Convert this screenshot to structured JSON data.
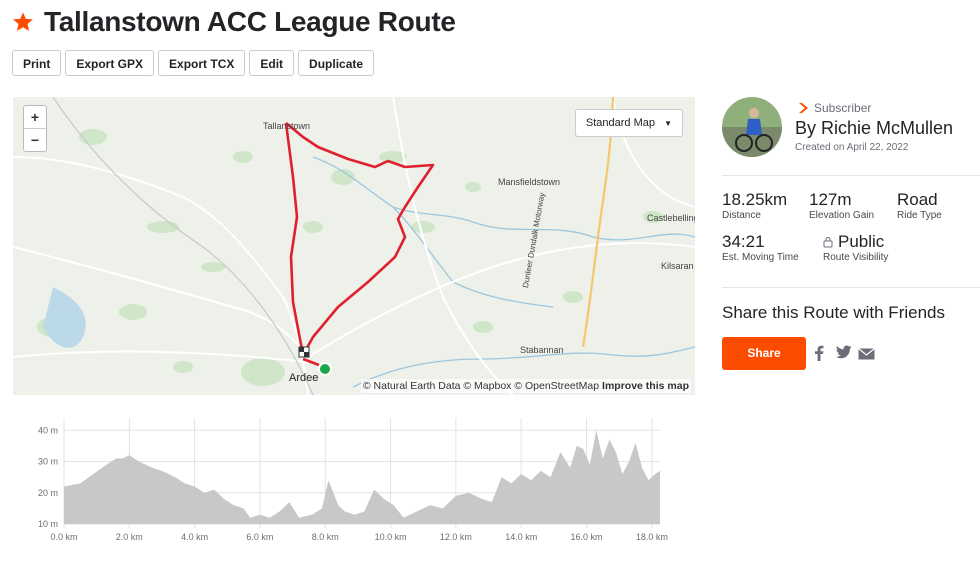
{
  "route": {
    "title": "Tallanstown ACC League Route"
  },
  "toolbar": {
    "print": "Print",
    "export_gpx": "Export GPX",
    "export_tcx": "Export TCX",
    "edit": "Edit",
    "duplicate": "Duplicate"
  },
  "map": {
    "style_select": "Standard Map",
    "zoom_in": "+",
    "zoom_out": "−",
    "attribution_prefix": "© Natural Earth Data © Mapbox © OpenStreetMap",
    "attribution_link": "Improve this map",
    "towns": {
      "tallanstown": "Tallanstown",
      "mansfieldstown": "Mansfieldstown",
      "castlebellingham": "Castlebellingh",
      "kilsaran": "Kilsaran",
      "stabannan": "Stabannan",
      "ardee": "Ardee",
      "motorway": "Dunleer Dundalk Motorway"
    },
    "route_color": "#e0202e"
  },
  "athlete": {
    "badge": "Subscriber",
    "name": "By Richie McMullen",
    "created": "Created on April 22, 2022"
  },
  "stats": {
    "distance": {
      "value": "18.25km",
      "label": "Distance"
    },
    "elevation": {
      "value": "127m",
      "label": "Elevation Gain"
    },
    "ride_type": {
      "value": "Road",
      "label": "Ride Type"
    },
    "moving_time": {
      "value": "34:21",
      "label": "Est. Moving Time"
    },
    "visibility": {
      "value": "Public",
      "label": "Route Visibility"
    }
  },
  "share": {
    "title": "Share this Route with Friends",
    "button": "Share"
  },
  "elevation_chart": {
    "y_ticks": [
      "40 m",
      "30 m",
      "20 m",
      "10 m"
    ],
    "x_ticks": [
      "0.0 km",
      "2.0 km",
      "4.0 km",
      "6.0 km",
      "8.0 km",
      "10.0 km",
      "12.0 km",
      "14.0 km",
      "16.0 km",
      "18.0 km"
    ]
  },
  "colors": {
    "accent": "#fc4c02",
    "text": "#242428",
    "route": "#e0202e",
    "profile_fill": "#c8c8c8"
  },
  "chart_data": {
    "type": "area",
    "xlabel": "",
    "ylabel": "",
    "xlim": [
      0,
      18.25
    ],
    "ylim": [
      10,
      42
    ],
    "x": [
      0,
      0.5,
      0.9,
      1.3,
      1.6,
      1.8,
      2.0,
      2.3,
      2.7,
      3.0,
      3.4,
      3.7,
      4.0,
      4.3,
      4.6,
      4.9,
      5.2,
      5.5,
      5.7,
      6.0,
      6.3,
      6.6,
      6.9,
      7.2,
      7.6,
      7.9,
      8.1,
      8.4,
      8.6,
      8.9,
      9.2,
      9.5,
      9.8,
      10.1,
      10.4,
      10.8,
      11.2,
      11.6,
      12.0,
      12.4,
      12.8,
      13.1,
      13.4,
      13.7,
      14.0,
      14.3,
      14.6,
      14.9,
      15.2,
      15.5,
      15.7,
      15.9,
      16.1,
      16.3,
      16.5,
      16.7,
      16.9,
      17.1,
      17.3,
      17.5,
      17.7,
      17.9,
      18.1,
      18.25
    ],
    "values": [
      22,
      23,
      26,
      29,
      31,
      31,
      32,
      30,
      28,
      27,
      25,
      23,
      22,
      20,
      21,
      18,
      16,
      15,
      12,
      13,
      12,
      14,
      17,
      12,
      13,
      15,
      24,
      16,
      14,
      13,
      14,
      21,
      18,
      16,
      12,
      14,
      16,
      15,
      19,
      20,
      18,
      17,
      25,
      23,
      26,
      24,
      27,
      25,
      33,
      28,
      35,
      34,
      29,
      40,
      31,
      37,
      33,
      26,
      30,
      36,
      28,
      24,
      26,
      27
    ]
  }
}
